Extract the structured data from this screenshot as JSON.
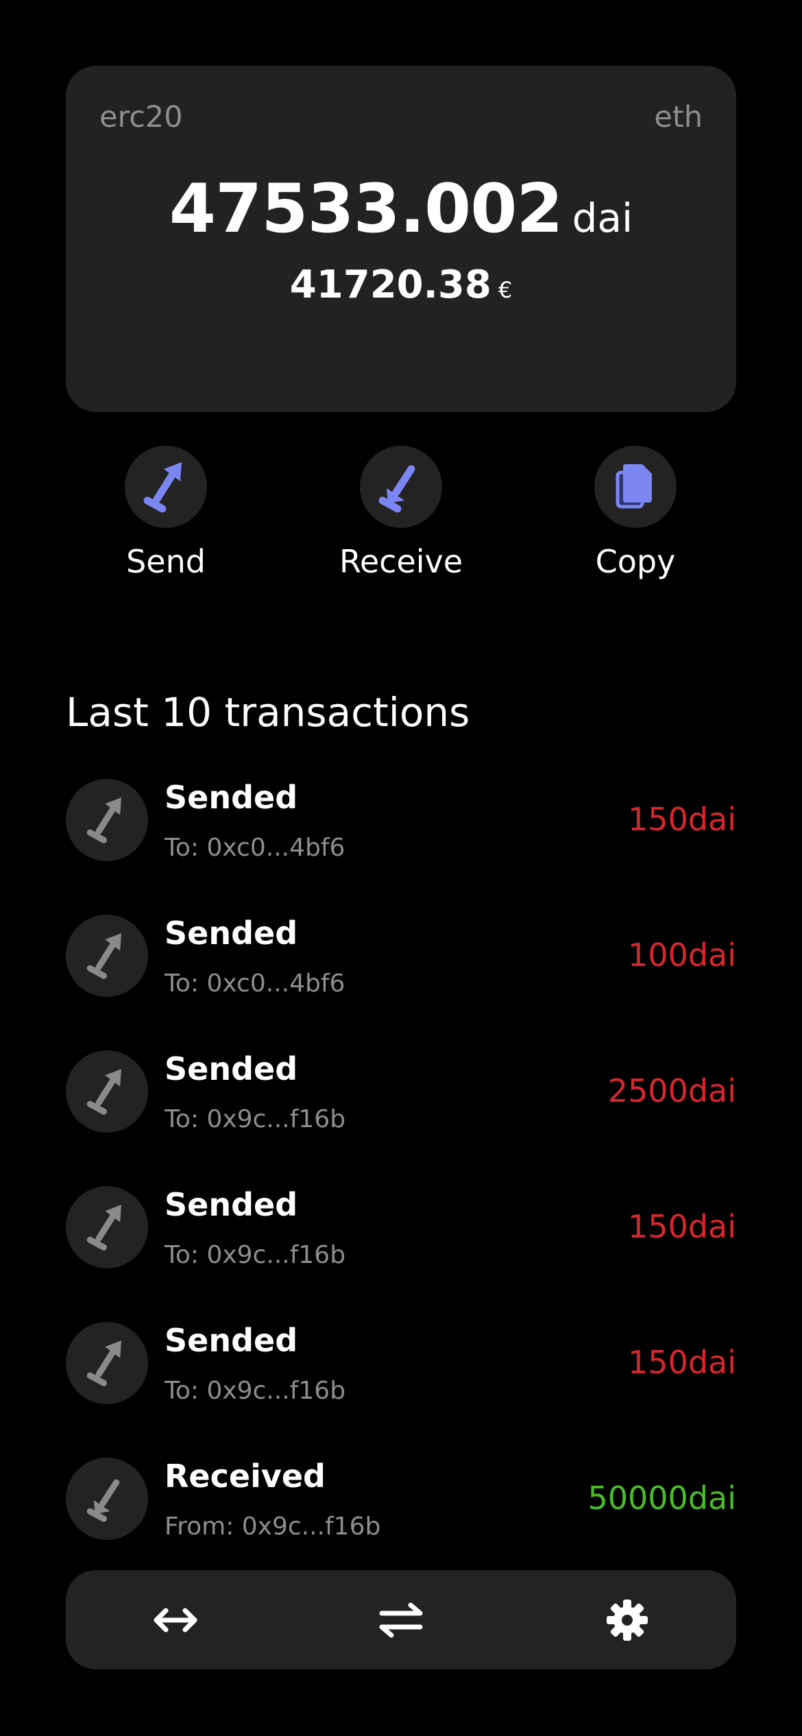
{
  "card": {
    "token_standard": "erc20",
    "network": "eth",
    "balance": "47533.002",
    "balance_unit": "dai",
    "fiat_balance": "41720.38",
    "fiat_unit": "€"
  },
  "actions": {
    "send_label": "Send",
    "receive_label": "Receive",
    "copy_label": "Copy"
  },
  "transactions": {
    "title": "Last 10 transactions",
    "items": [
      {
        "title": "Sended",
        "subtitle": "To: 0xc0...4bf6",
        "amount": "150dai",
        "direction": "out"
      },
      {
        "title": "Sended",
        "subtitle": "To: 0xc0...4bf6",
        "amount": "100dai",
        "direction": "out"
      },
      {
        "title": "Sended",
        "subtitle": "To: 0x9c...f16b",
        "amount": "2500dai",
        "direction": "out"
      },
      {
        "title": "Sended",
        "subtitle": "To: 0x9c...f16b",
        "amount": "150dai",
        "direction": "out"
      },
      {
        "title": "Sended",
        "subtitle": "To: 0x9c...f16b",
        "amount": "150dai",
        "direction": "out"
      },
      {
        "title": "Received",
        "subtitle": "From: 0x9c...f16b",
        "amount": "50000dai",
        "direction": "in"
      }
    ]
  },
  "nav": {
    "items": [
      "transfer-arrows-icon",
      "swap-arrows-icon",
      "gear-icon"
    ]
  },
  "colors": {
    "accent": "#7b86f2",
    "sent": "#d9262e",
    "received": "#4bbd2a"
  }
}
